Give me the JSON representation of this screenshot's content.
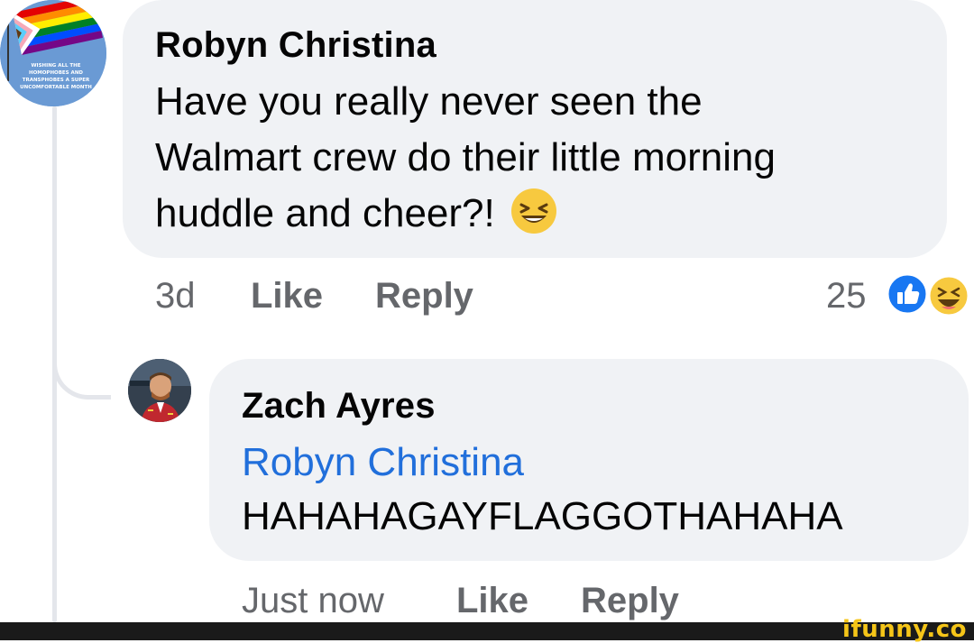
{
  "comment": {
    "author": "Robyn Christina",
    "text_line1": "Have you really never seen the",
    "text_line2": "Walmart crew do their little morning",
    "text_line3": "huddle and cheer?!",
    "emoji_icon": "laughing-face-icon",
    "timestamp": "3d",
    "like_label": "Like",
    "reply_label": "Reply",
    "reaction_count": "25",
    "reaction_icons": [
      "like-reaction-icon",
      "haha-reaction-icon"
    ],
    "avatar_badge_text": "WISHING ALL THE HOMOPHOBES AND TRANSPHOBES A SUPER UNCOMFORTABLE MONTH"
  },
  "reply": {
    "author": "Zach Ayres",
    "mention": "Robyn Christina",
    "text": "HAHAHAGAYFLAGGOTHAHAHA",
    "timestamp": "Just now",
    "like_label": "Like",
    "reply_label": "Reply"
  },
  "watermark": "ifunny.co",
  "colors": {
    "bubble": "#f0f2f5",
    "mention": "#216fdb",
    "meta": "#65676b",
    "like_blue": "#1877f2",
    "haha_yellow": "#f7c93f",
    "watermark": "#f5c518"
  }
}
